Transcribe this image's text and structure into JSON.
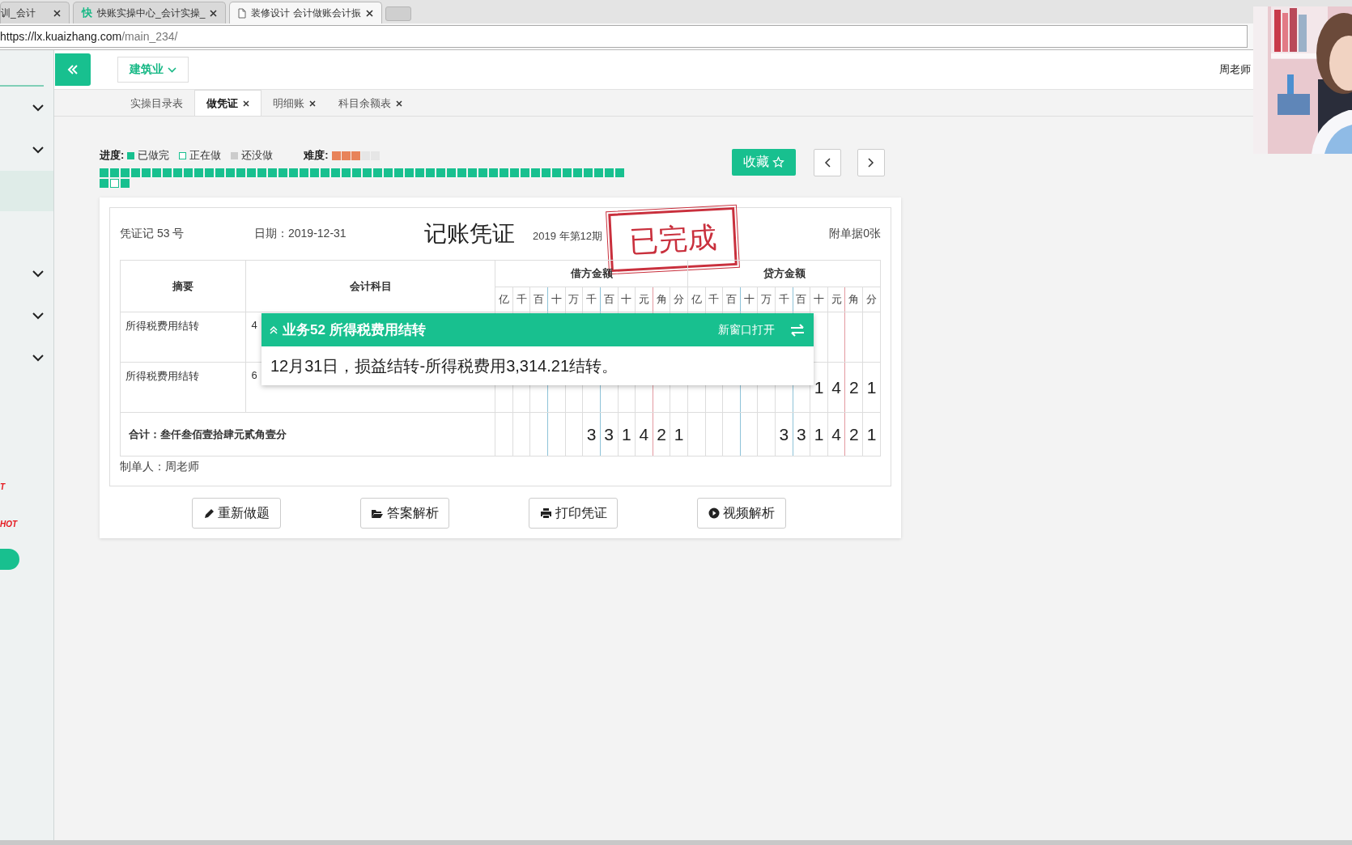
{
  "browser": {
    "tabs": [
      {
        "title": "训_会计",
        "kind": "plain",
        "selected": false
      },
      {
        "title": "快账实操中心_会计实操_",
        "kind": "logo",
        "logo": "快",
        "selected": false
      },
      {
        "title": "装修设计 会计做账会计振",
        "kind": "page",
        "selected": true
      }
    ],
    "address": {
      "host": "https://lx.kuaizhang.com",
      "path": "/main_234/"
    }
  },
  "sidebar": {
    "items": [
      {
        "kind": "field"
      },
      {
        "kind": "group"
      },
      {
        "kind": "group"
      },
      {
        "kind": "active"
      },
      {
        "kind": "group"
      },
      {
        "kind": "group"
      },
      {
        "kind": "group"
      },
      {
        "kind": "hot",
        "text": "T"
      },
      {
        "kind": "hot",
        "text": "HOT"
      },
      {
        "kind": "pill"
      }
    ]
  },
  "topbar": {
    "industry": "建筑业",
    "user": "周老师"
  },
  "page_tabs": [
    {
      "label": "实操目录表",
      "selected": false,
      "closable": false
    },
    {
      "label": "做凭证",
      "selected": true,
      "closable": true
    },
    {
      "label": "明细账",
      "selected": false,
      "closable": true
    },
    {
      "label": "科目余额表",
      "selected": false,
      "closable": true
    }
  ],
  "progress": {
    "label": "进度:",
    "legend": [
      {
        "label": "已做完",
        "kind": "done"
      },
      {
        "label": "正在做",
        "kind": "current"
      },
      {
        "label": "还没做",
        "kind": "todo"
      }
    ],
    "difficulty_label": "难度:",
    "stars": 3,
    "items": [
      {
        "done": true,
        "current": false
      },
      {
        "done": true,
        "current": false
      },
      {
        "done": true,
        "current": false
      },
      {
        "done": true,
        "current": false
      },
      {
        "done": true,
        "current": false
      },
      {
        "done": true,
        "current": false
      },
      {
        "done": true,
        "current": false
      },
      {
        "done": true,
        "current": false
      },
      {
        "done": true,
        "current": false
      },
      {
        "done": true,
        "current": false
      },
      {
        "done": true,
        "current": false
      },
      {
        "done": true,
        "current": false
      },
      {
        "done": true,
        "current": false
      },
      {
        "done": true,
        "current": false
      },
      {
        "done": true,
        "current": false
      },
      {
        "done": true,
        "current": false
      },
      {
        "done": true,
        "current": false
      },
      {
        "done": true,
        "current": false
      },
      {
        "done": true,
        "current": false
      },
      {
        "done": true,
        "current": false
      },
      {
        "done": true,
        "current": false
      },
      {
        "done": true,
        "current": false
      },
      {
        "done": true,
        "current": false
      },
      {
        "done": true,
        "current": false
      },
      {
        "done": true,
        "current": false
      },
      {
        "done": true,
        "current": false
      },
      {
        "done": true,
        "current": false
      },
      {
        "done": true,
        "current": false
      },
      {
        "done": true,
        "current": false
      },
      {
        "done": true,
        "current": false
      },
      {
        "done": true,
        "current": false
      },
      {
        "done": true,
        "current": false
      },
      {
        "done": true,
        "current": false
      },
      {
        "done": true,
        "current": false
      },
      {
        "done": true,
        "current": false
      },
      {
        "done": true,
        "current": false
      },
      {
        "done": true,
        "current": false
      },
      {
        "done": true,
        "current": false
      },
      {
        "done": true,
        "current": false
      },
      {
        "done": true,
        "current": false
      },
      {
        "done": true,
        "current": false
      },
      {
        "done": true,
        "current": false
      },
      {
        "done": true,
        "current": false
      },
      {
        "done": true,
        "current": false
      },
      {
        "done": true,
        "current": false
      },
      {
        "done": true,
        "current": false
      },
      {
        "done": true,
        "current": false
      },
      {
        "done": true,
        "current": false
      },
      {
        "done": true,
        "current": false
      },
      {
        "done": true,
        "current": false
      },
      {
        "done": true,
        "current": false
      },
      {
        "done": false,
        "current": true
      },
      {
        "done": true,
        "current": false
      }
    ],
    "favorite": "收藏"
  },
  "voucher": {
    "number": "凭证记 53 号",
    "date": "日期：2019-12-31",
    "title": "记账凭证",
    "period": "2019 年第12期",
    "attachments": "附单据0张",
    "stamp": "已完成",
    "summary_header": "摘要",
    "account_header": "会计科目",
    "debit_header": "借方金额",
    "credit_header": "贷方金额",
    "debit_digits": [
      "亿",
      "千",
      "百",
      "十",
      "万",
      "千",
      "百",
      "十",
      "元",
      "角",
      "分"
    ],
    "credit_digits": [
      "亿",
      "千",
      "百",
      "十",
      "万",
      "千",
      "百",
      "十",
      "元",
      "角",
      "分"
    ],
    "rows": [
      {
        "summary": "所得税费用结转",
        "account": "4",
        "credit": []
      },
      {
        "summary": "所得税费用结转",
        "account": "6",
        "credit": [
          "1",
          "4",
          "2",
          "1"
        ]
      }
    ],
    "total": {
      "label": "合计：叁仟叁佰壹拾肆元贰角壹分",
      "debit": [
        "3",
        "3",
        "1",
        "4",
        "2",
        "1"
      ],
      "credit": [
        "3",
        "3",
        "1",
        "4",
        "2",
        "1"
      ]
    },
    "preparer": "制单人：周老师",
    "popup": {
      "title": "业务52 所得税费用结转",
      "open_new": "新窗口打开",
      "text": "12月31日，损益结转-所得税费用3,314.21结转。"
    }
  },
  "actions": [
    {
      "label": "重新做题",
      "kind": "pencil"
    },
    {
      "label": "答案解析",
      "kind": "folder"
    },
    {
      "label": "打印凭证",
      "kind": "printer"
    },
    {
      "label": "视频解析",
      "kind": "play"
    }
  ]
}
